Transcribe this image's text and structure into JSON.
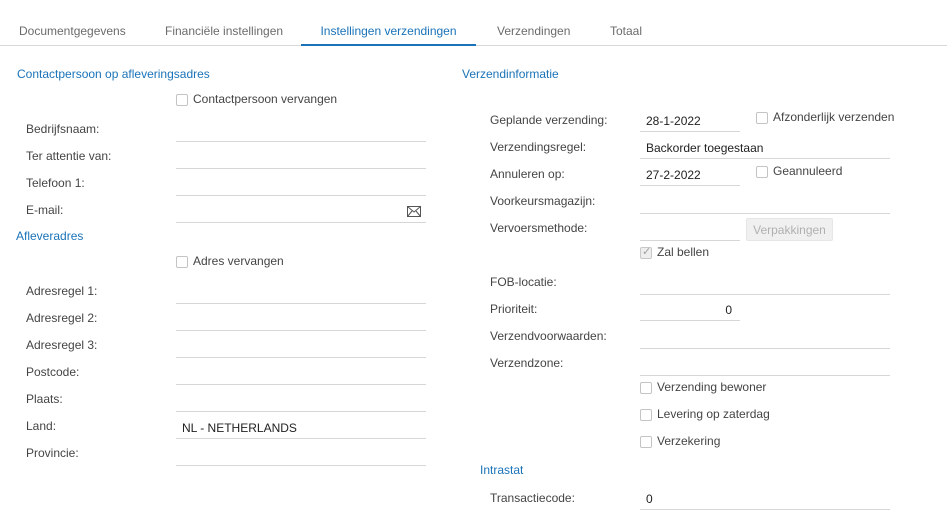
{
  "tabs": [
    {
      "label": "Documentgegevens"
    },
    {
      "label": "Financiële instellingen"
    },
    {
      "label": "Instellingen verzendingen"
    },
    {
      "label": "Verzendingen"
    },
    {
      "label": "Totaal"
    }
  ],
  "active_tab": "Instellingen verzendingen",
  "contact": {
    "title": "Contactpersoon op afleveringsadres",
    "override_label": "Contactpersoon vervangen",
    "company_label": "Bedrijfsnaam:",
    "attention_label": "Ter attentie van:",
    "phone_label": "Telefoon 1:",
    "email_label": "E-mail:",
    "company_value": "",
    "attention_value": "",
    "phone_value": "",
    "email_value": ""
  },
  "address": {
    "title": "Afleveradres",
    "override_label": "Adres vervangen",
    "line1_label": "Adresregel 1:",
    "line2_label": "Adresregel 2:",
    "line3_label": "Adresregel 3:",
    "postcode_label": "Postcode:",
    "city_label": "Plaats:",
    "country_label": "Land:",
    "country_value": "NL - NETHERLANDS",
    "province_label": "Provincie:"
  },
  "shipping": {
    "title": "Verzendinformatie",
    "planned_label": "Geplande verzending:",
    "planned_value": "28-1-2022",
    "separate_label": "Afzonderlijk verzenden",
    "rule_label": "Verzendingsregel:",
    "rule_value": "Backorder toegestaan",
    "cancel_label": "Annuleren op:",
    "cancel_value": "27-2-2022",
    "cancelled_label": "Geannuleerd",
    "warehouse_label": "Voorkeursmagazijn:",
    "carrier_label": "Vervoersmethode:",
    "packages_button": "Verpakkingen",
    "will_call_label": "Zal bellen",
    "fob_label": "FOB-locatie:",
    "priority_label": "Prioriteit:",
    "priority_value": "0",
    "terms_label": "Verzendvoorwaarden:",
    "zone_label": "Verzendzone:",
    "residential_label": "Verzending bewoner",
    "saturday_label": "Levering op zaterdag",
    "insurance_label": "Verzekering"
  },
  "intrastat": {
    "title": "Intrastat",
    "transaction_label": "Transactiecode:",
    "transaction_value": "0"
  },
  "colors": {
    "accent": "#1a73b8",
    "border": "#d6d6d6",
    "muted": "#6b6b6b"
  }
}
